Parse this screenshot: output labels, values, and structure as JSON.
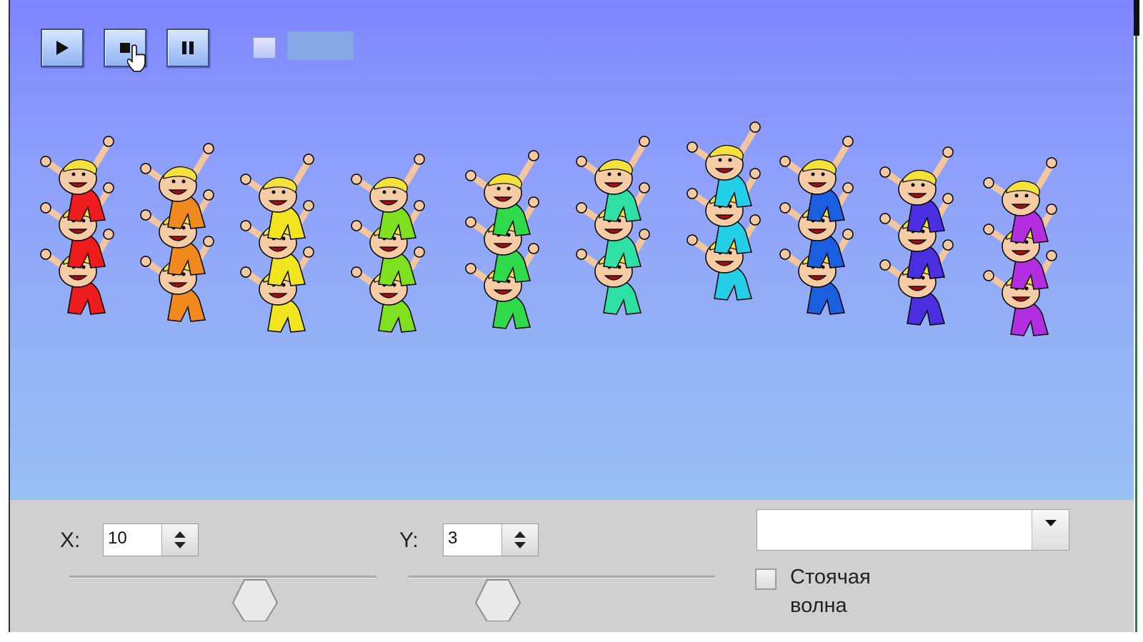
{
  "toolbar": {
    "buttons": [
      {
        "name": "play",
        "icon": "play-icon"
      },
      {
        "name": "stop",
        "icon": "stop-icon"
      },
      {
        "name": "pause",
        "icon": "pause-icon"
      }
    ]
  },
  "scene": {
    "columns": 10,
    "rows": 3,
    "colors": [
      "#ee1c1c",
      "#f08a1e",
      "#f0e51e",
      "#7ee01e",
      "#2ed94a",
      "#2ee0a4",
      "#22cfe6",
      "#1a5fe0",
      "#4a2ee0",
      "#b22ee0"
    ]
  },
  "controls": {
    "x": {
      "label": "X:",
      "value": "10"
    },
    "y": {
      "label": "Y:",
      "value": "3"
    },
    "mode_select": {
      "value": ""
    },
    "standing_wave": {
      "label": "Стоячая волна",
      "checked": false
    }
  }
}
